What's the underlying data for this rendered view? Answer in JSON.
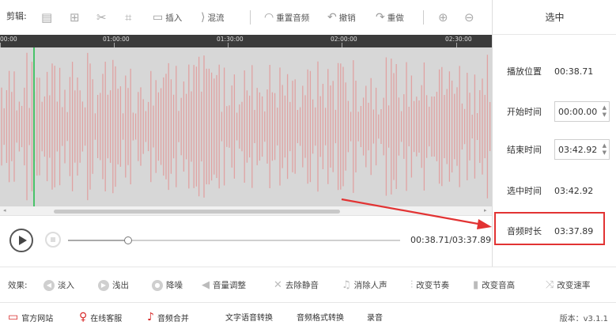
{
  "toolbar": {
    "label": "剪辑:",
    "insert": "插入",
    "mix": "混流",
    "reset_audio": "重置音频",
    "undo": "撤销",
    "redo": "重做"
  },
  "timeline": {
    "ticks": [
      "00:00",
      "01:00:00",
      "01:30:00",
      "02:00:00",
      "02:30:00"
    ]
  },
  "player": {
    "time_readout": "00:38.71/03:37.89",
    "progress": 0.18
  },
  "right_panel": {
    "header": "选中",
    "play_position_label": "播放位置",
    "play_position_value": "00:38.71",
    "start_time_label": "开始时间",
    "start_time_value": "00:00.00",
    "end_time_label": "结束时间",
    "end_time_value": "03:42.92",
    "selected_time_label": "选中时间",
    "selected_time_value": "03:42.92",
    "duration_label": "音频时长",
    "duration_value": "03:37.89"
  },
  "effects": {
    "label": "效果:",
    "items": [
      "淡入",
      "浅出",
      "降噪",
      "音量调整",
      "去除静音",
      "消除人声",
      "改变节奏",
      "改变音高",
      "改变速率"
    ]
  },
  "bottom": {
    "items": [
      "官方网站",
      "在线客服",
      "音频合并",
      "文字语音转换",
      "音频格式转换",
      "录音"
    ],
    "version": "版本：v3.1.1"
  },
  "colors": {
    "waveform": "#e0a2a2",
    "playhead": "#49c36a",
    "highlight": "#e23333"
  }
}
